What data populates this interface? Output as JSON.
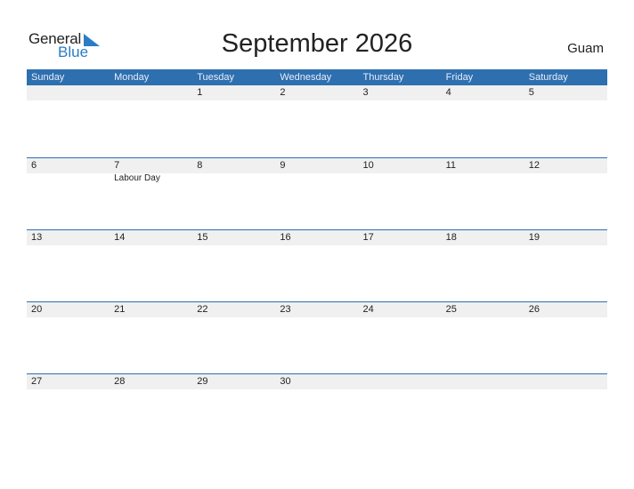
{
  "logo": {
    "general": "General",
    "blue": "Blue",
    "icon": "flag-triangle-icon"
  },
  "title": "September 2026",
  "region": "Guam",
  "colors": {
    "header": "#2e6fb0",
    "accent": "#2a7cc7",
    "band": "#f0f0f0"
  },
  "weekdays": [
    "Sunday",
    "Monday",
    "Tuesday",
    "Wednesday",
    "Thursday",
    "Friday",
    "Saturday"
  ],
  "weeks": [
    [
      {
        "day": ""
      },
      {
        "day": ""
      },
      {
        "day": "1"
      },
      {
        "day": "2"
      },
      {
        "day": "3"
      },
      {
        "day": "4"
      },
      {
        "day": "5"
      }
    ],
    [
      {
        "day": "6"
      },
      {
        "day": "7",
        "event": "Labour Day"
      },
      {
        "day": "8"
      },
      {
        "day": "9"
      },
      {
        "day": "10"
      },
      {
        "day": "11"
      },
      {
        "day": "12"
      }
    ],
    [
      {
        "day": "13"
      },
      {
        "day": "14"
      },
      {
        "day": "15"
      },
      {
        "day": "16"
      },
      {
        "day": "17"
      },
      {
        "day": "18"
      },
      {
        "day": "19"
      }
    ],
    [
      {
        "day": "20"
      },
      {
        "day": "21"
      },
      {
        "day": "22"
      },
      {
        "day": "23"
      },
      {
        "day": "24"
      },
      {
        "day": "25"
      },
      {
        "day": "26"
      }
    ],
    [
      {
        "day": "27"
      },
      {
        "day": "28"
      },
      {
        "day": "29"
      },
      {
        "day": "30"
      },
      {
        "day": ""
      },
      {
        "day": ""
      },
      {
        "day": ""
      }
    ]
  ]
}
